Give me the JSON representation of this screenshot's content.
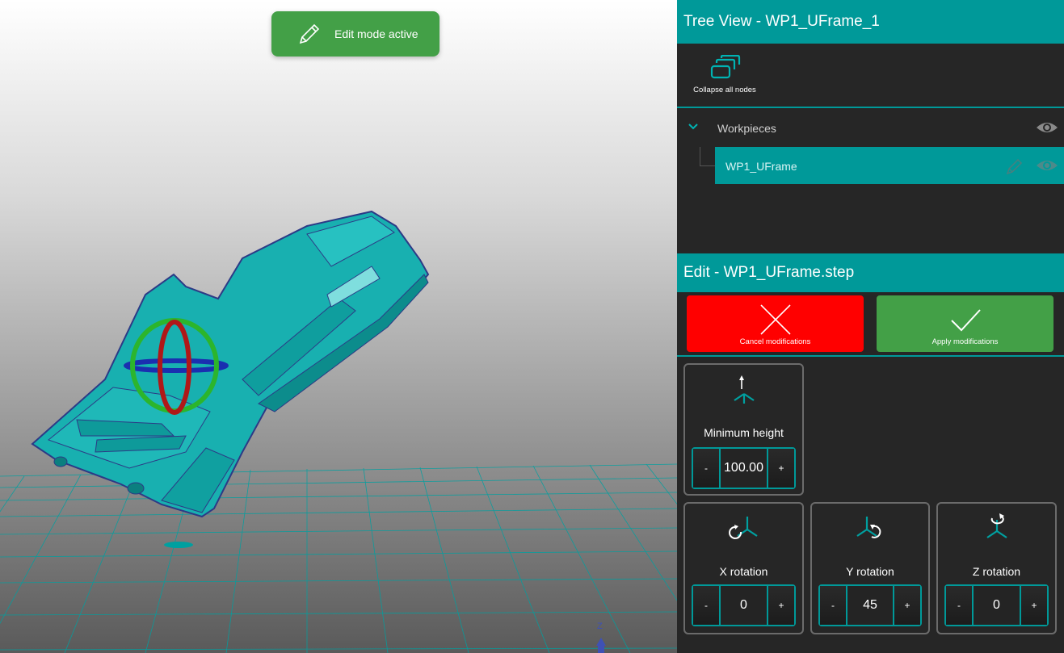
{
  "viewport": {
    "toast": {
      "text": "Edit mode active",
      "icon": "pencil-icon",
      "color": "#43a047"
    },
    "axis_label": "Z",
    "accent": "#00a0a0"
  },
  "tree_view": {
    "title": "Tree View - WP1_UFrame_1",
    "collapse_label": "Collapse all nodes",
    "collapse_icon": "collapse-all-icon",
    "nodes": [
      {
        "label": "Workpieces",
        "expanded": true,
        "visible": true
      },
      {
        "label": "WP1_UFrame",
        "selected": true,
        "visible": true
      }
    ]
  },
  "edit": {
    "title": "Edit - WP1_UFrame.step",
    "cancel_label": "Cancel modifications",
    "apply_label": "Apply modifications",
    "cancel_color": "#ff0000",
    "apply_color": "#43a047",
    "min_height": {
      "label": "Minimum height",
      "value": "100.00",
      "icon": "min-height-icon"
    },
    "x_rotation": {
      "label": "X rotation",
      "value": "0",
      "icon": "x-rotation-icon"
    },
    "y_rotation": {
      "label": "Y rotation",
      "value": "45",
      "icon": "y-rotation-icon"
    },
    "z_rotation": {
      "label": "Z rotation",
      "value": "0",
      "icon": "z-rotation-icon"
    },
    "minus": "-",
    "plus": "+"
  },
  "colors": {
    "header": "#009999",
    "panel_bg": "#262626"
  }
}
